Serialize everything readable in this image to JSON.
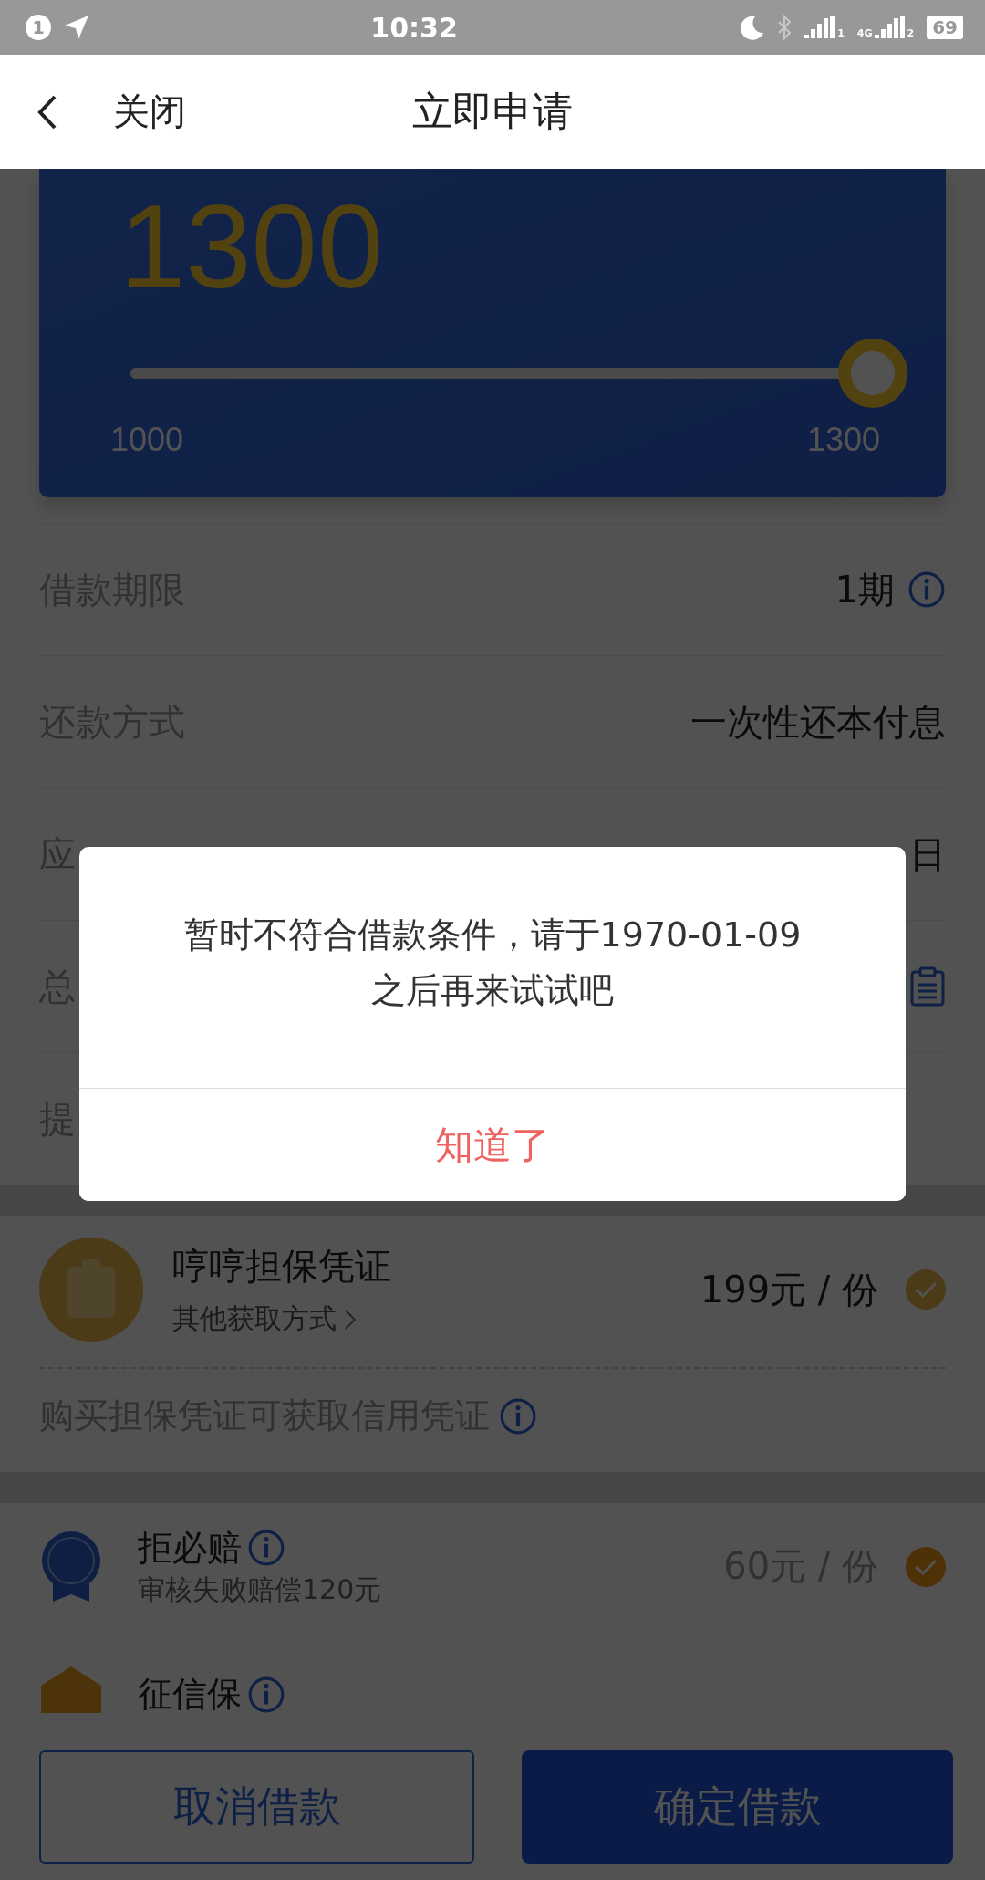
{
  "status_bar": {
    "notification_count": "1",
    "time": "10:32",
    "signals": [
      {
        "sim": "1"
      },
      {
        "sim": "2",
        "network": "4G"
      }
    ],
    "battery": "69"
  },
  "header": {
    "close": "关闭",
    "title": "立即申请"
  },
  "amount_card": {
    "amount": "1300",
    "slider": {
      "level": 1.0
    },
    "min": "1000",
    "max": "1300"
  },
  "details": [
    {
      "label": "借款期限",
      "value": "1期",
      "kind": "info"
    },
    {
      "label": "还款方式",
      "value": "一次性还本付息",
      "kind": "plain"
    },
    {
      "label": "应",
      "value": "日",
      "kind": "plain"
    },
    {
      "label": "总",
      "kind": "clipboard"
    },
    {
      "label": "提",
      "kind": "plain"
    }
  ],
  "guarantee": {
    "title": "哼哼担保凭证",
    "link": "其他获取方式",
    "price": "199元 / 份",
    "checked": true,
    "note": "购买担保凭证可获取信用凭证"
  },
  "addons": [
    {
      "title": "拒必赔",
      "subtitle": "审核失败赔偿120元",
      "price": "60元 / 份",
      "checked": true,
      "kind": "compensation"
    },
    {
      "title": "征信保",
      "kind": "credit"
    }
  ],
  "buttons": {
    "cancel": "取消借款",
    "confirm": "确定借款"
  },
  "dialog": {
    "lines": [
      "暂时不符合借款条件，请于1970-01-09",
      "之后再来试试吧"
    ],
    "button": "知道了"
  }
}
